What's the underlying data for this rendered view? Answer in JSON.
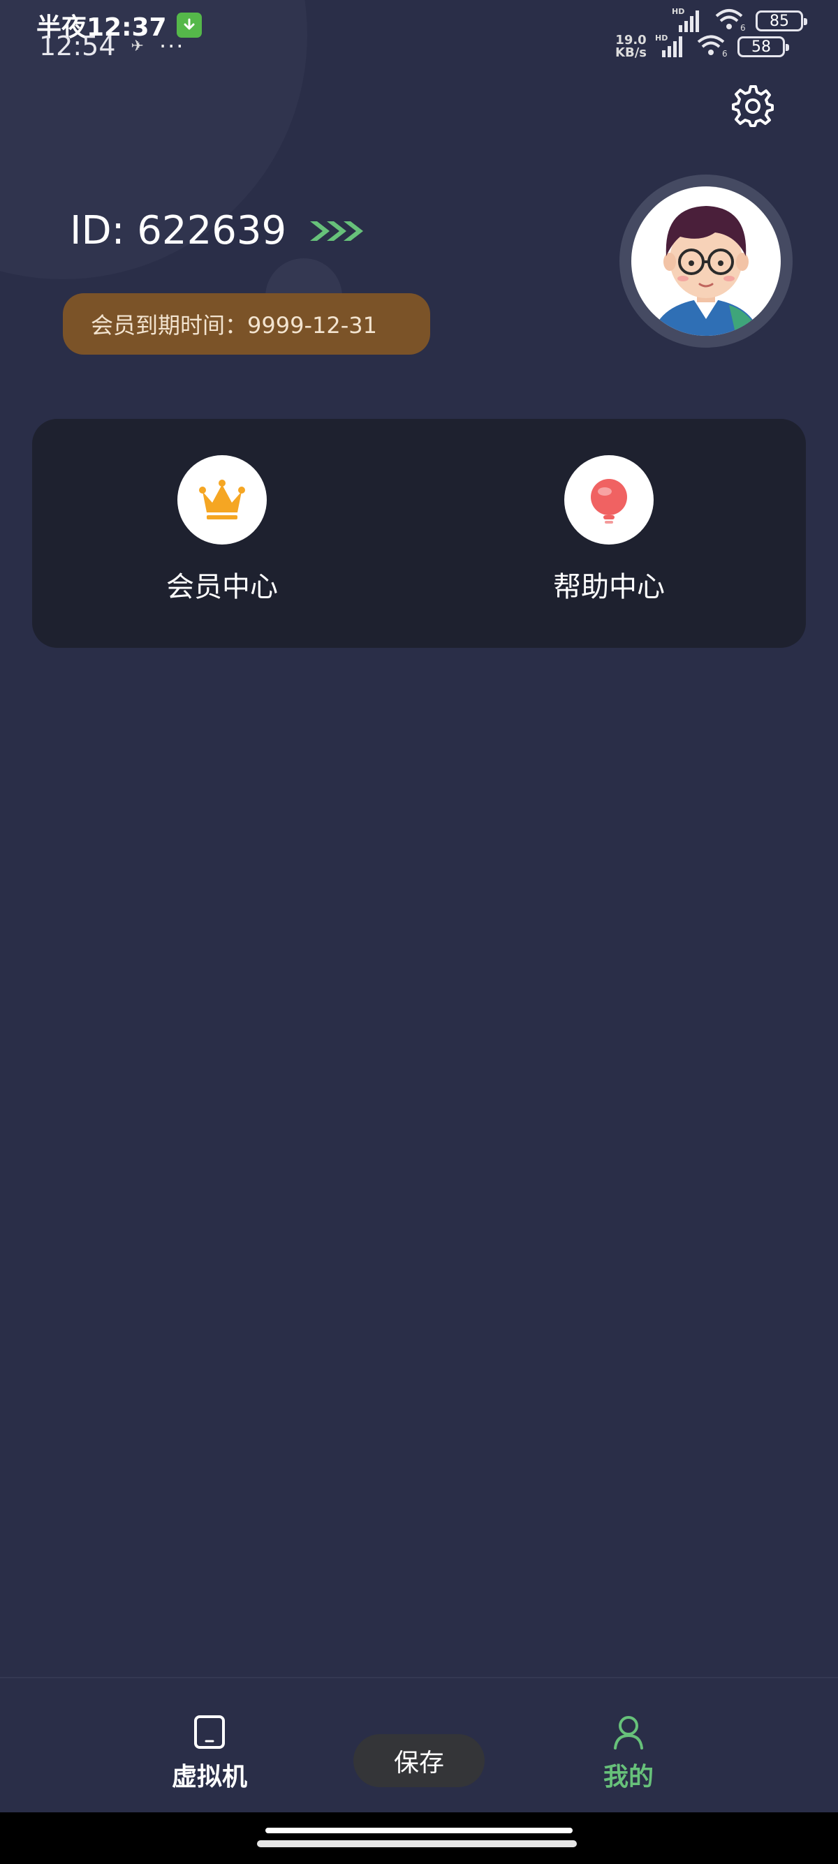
{
  "status_bar": {
    "primary_time": "半夜12:37",
    "secondary_time": "12:54",
    "more_dots": "···",
    "battery_primary": "85",
    "battery_secondary": "58",
    "network_speed_value": "19.0",
    "network_speed_unit": "KB/s",
    "hd_label": "HD",
    "wifi_badge": "6"
  },
  "profile": {
    "id_text": "ID: 622639",
    "membership_expiry": "会员到期时间：9999-12-31"
  },
  "quick_menu": [
    {
      "label": "会员中心",
      "icon": "crown-icon"
    },
    {
      "label": "帮助中心",
      "icon": "help-bulb-icon"
    }
  ],
  "bottom_nav": {
    "vm_label": "虚拟机",
    "mine_label": "我的",
    "save_label": "保存"
  },
  "colors": {
    "background": "#2a2e48",
    "card": "#1e212f",
    "accent_green": "#67c17a",
    "member_pill": "#7b5328",
    "crown": "#f5a623",
    "help": "#f06262"
  }
}
